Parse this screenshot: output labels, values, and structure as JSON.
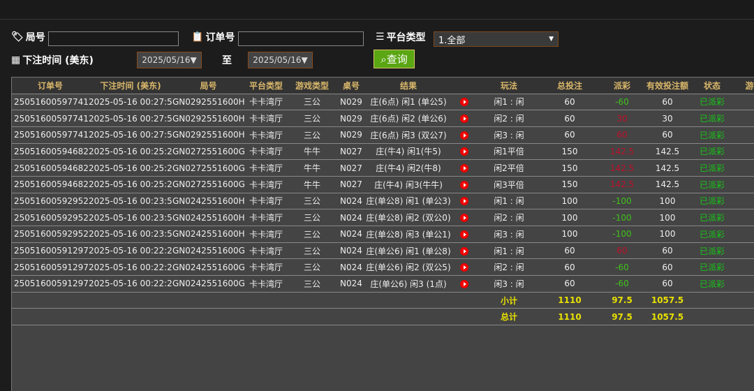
{
  "filters": {
    "round_label": "局号",
    "round_value": "",
    "order_label": "订单号",
    "order_value": "",
    "platform_label": "平台类型",
    "platform_value": "1.全部",
    "time_label": "下注时间 (美东)",
    "date_from": "2025/05/16▼",
    "to_label": "至",
    "date_to": "2025/05/16▼",
    "query_label": "查询"
  },
  "table": {
    "headers": [
      "订单号",
      "下注时间 (美东)",
      "局号",
      "平台类型",
      "游戏类型",
      "桌号",
      "结果",
      "",
      "玩法",
      "总投注",
      "派彩",
      "有效投注额",
      "状态",
      "游戏"
    ],
    "rows": [
      [
        "250516005977413",
        "2025-05-16 00:27:58",
        "GN0292551600H",
        "卡卡湾厅",
        "三公",
        "N029",
        "庄(6点) 闲1 (单公5)",
        "闲1 : 闲",
        "60",
        "-60",
        "60",
        "已派彩"
      ],
      [
        "250516005977412",
        "2025-05-16 00:27:58",
        "GN0292551600H",
        "卡卡湾厅",
        "三公",
        "N029",
        "庄(6点) 闲2 (单公6)",
        "闲2 : 闲",
        "60",
        "30",
        "30",
        "已派彩"
      ],
      [
        "250516005977410",
        "2025-05-16 00:27:58",
        "GN0292551600H",
        "卡卡湾厅",
        "三公",
        "N029",
        "庄(6点) 闲3 (双公7)",
        "闲3 : 闲",
        "60",
        "60",
        "60",
        "已派彩"
      ],
      [
        "250516005946822",
        "2025-05-16 00:25:20",
        "GN0272551600G",
        "卡卡湾厅",
        "牛牛",
        "N027",
        "庄(牛4) 闲1(牛5)",
        "闲1平倍",
        "150",
        "142.5",
        "142.5",
        "已派彩"
      ],
      [
        "250516005946821",
        "2025-05-16 00:25:20",
        "GN0272551600G",
        "卡卡湾厅",
        "牛牛",
        "N027",
        "庄(牛4) 闲2(牛8)",
        "闲2平倍",
        "150",
        "142.5",
        "142.5",
        "已派彩"
      ],
      [
        "250516005946820",
        "2025-05-16 00:25:20",
        "GN0272551600G",
        "卡卡湾厅",
        "牛牛",
        "N027",
        "庄(牛4) 闲3(牛牛)",
        "闲3平倍",
        "150",
        "142.5",
        "142.5",
        "已派彩"
      ],
      [
        "250516005929522",
        "2025-05-16 00:23:51",
        "GN0242551600H",
        "卡卡湾厅",
        "三公",
        "N024",
        "庄(单公8) 闲1 (单公3)",
        "闲1 : 闲",
        "100",
        "-100",
        "100",
        "已派彩"
      ],
      [
        "250516005929521",
        "2025-05-16 00:23:51",
        "GN0242551600H",
        "卡卡湾厅",
        "三公",
        "N024",
        "庄(单公8) 闲2 (双公0)",
        "闲2 : 闲",
        "100",
        "-100",
        "100",
        "已派彩"
      ],
      [
        "250516005929520",
        "2025-05-16 00:23:51",
        "GN0242551600H",
        "卡卡湾厅",
        "三公",
        "N024",
        "庄(单公8) 闲3 (单公1)",
        "闲3 : 闲",
        "100",
        "-100",
        "100",
        "已派彩"
      ],
      [
        "250516005912975",
        "2025-05-16 00:22:24",
        "GN0242551600G",
        "卡卡湾厅",
        "三公",
        "N024",
        "庄(单公6) 闲1 (单公8)",
        "闲1 : 闲",
        "60",
        "60",
        "60",
        "已派彩"
      ],
      [
        "250516005912974",
        "2025-05-16 00:22:24",
        "GN0242551600G",
        "卡卡湾厅",
        "三公",
        "N024",
        "庄(单公6) 闲2 (双公5)",
        "闲2 : 闲",
        "60",
        "-60",
        "60",
        "已派彩"
      ],
      [
        "250516005912973",
        "2025-05-16 00:22:24",
        "GN0242551600G",
        "卡卡湾厅",
        "三公",
        "N024",
        "庄(单公6) 闲3 (1点)",
        "闲3 : 闲",
        "60",
        "-60",
        "60",
        "已派彩"
      ]
    ],
    "subtotal": {
      "label": "小计",
      "bet": "1110",
      "payout": "97.5",
      "valid": "1057.5"
    },
    "total": {
      "label": "总计",
      "bet": "1110",
      "payout": "97.5",
      "valid": "1057.5"
    }
  },
  "colors": {
    "negative": "#3fc31a",
    "positive": "#c0102a",
    "status": "#17c817",
    "header": "#d9b76a",
    "sum": "#e8e000",
    "button": "#5aa613"
  }
}
